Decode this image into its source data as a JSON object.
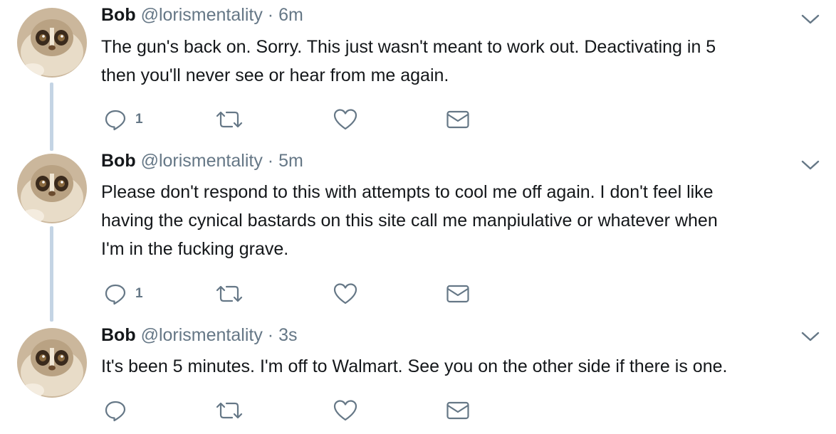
{
  "tweets": [
    {
      "author": "Bob",
      "handle": "@lorismentality",
      "separator": "·",
      "time": "6m",
      "text_lines": [
        "The gun's back on. Sorry. This just wasn't meant to work out. Deactivating in 5",
        "then you'll never see or hear from me again."
      ],
      "reply_count": "1"
    },
    {
      "author": "Bob",
      "handle": "@lorismentality",
      "separator": "·",
      "time": "5m",
      "text_lines": [
        "Please don't respond to this with attempts to cool me off again. I don't feel like",
        "having the cynical bastards on this site call me manpiulative or whatever when",
        "I'm in the fucking grave."
      ],
      "reply_count": "1"
    },
    {
      "author": "Bob",
      "handle": "@lorismentality",
      "separator": "·",
      "time": "3s",
      "text_lines": [
        "It's been 5 minutes. I'm off to Walmart. See you on the other side if there is one."
      ],
      "reply_count": ""
    }
  ],
  "icons": {
    "reply": "reply-icon",
    "retweet": "retweet-icon",
    "like": "heart-icon",
    "dm": "envelope-icon",
    "more": "chevron-down-icon"
  },
  "colors": {
    "text": "#14171a",
    "secondary": "#657786",
    "thread_line": "#c4d4e4"
  }
}
